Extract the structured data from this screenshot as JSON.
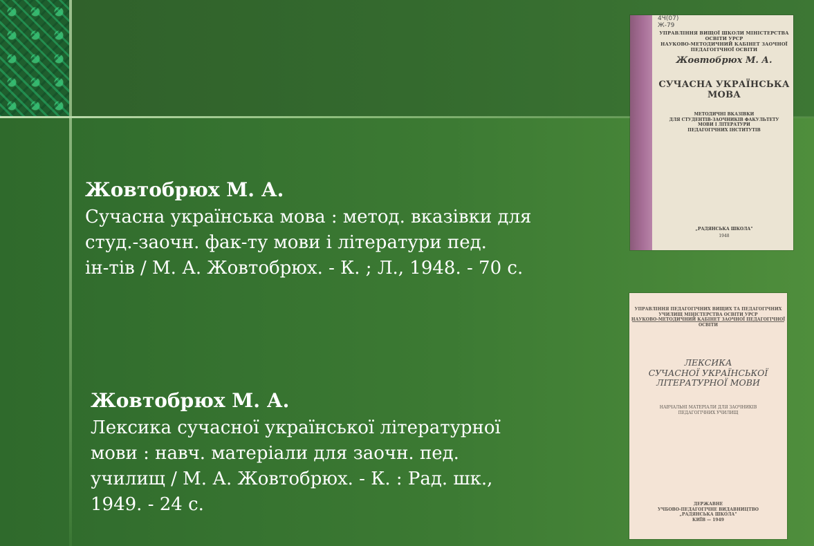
{
  "entries": [
    {
      "author": "Жовтобрюх М. А.",
      "description": "Сучасна українська мова : метод. вказівки для\nстуд.-заочн. фак-ту мови і літератури пед.\nін-тів / М. А. Жовтобрюх. - К. ; Л., 1948. - 70 с."
    },
    {
      "author": "Жовтобрюх М. А.",
      "description": "Лексика сучасної української літературної\nмови : навч. матеріали для заочн. пед.\nучилищ / М. А. Жовтобрюх. - К. : Рад. шк.,\n1949. - 24 с."
    }
  ],
  "covers": [
    {
      "shelf_mark": "4Ч(07)\nЖ-79",
      "header": "УПРАВЛІННЯ ВИЩОЇ ШКОЛИ МІНІСТЕРСТВА ОСВІТИ УРСР\nНАУКОВО-МЕТОДИЧНИЙ КАБІНЕТ ЗАОЧНОЇ ПЕДАГОГІЧНОЇ ОСВІТИ",
      "author": "Жовтобрюх М. А.",
      "title": "СУЧАСНА УКРАЇНСЬКА МОВА",
      "subtitle": "МЕТОДИЧНІ ВКАЗІВКИ\nДЛЯ СТУДЕНТІВ-ЗАОЧНИКІВ ФАКУЛЬТЕТУ\nМОВИ І ЛІТЕРАТУРИ\nПЕДАГОГІЧНИХ ІНСТИТУТІВ",
      "publisher": "„РАДЯНСЬКА ШКОЛА\"",
      "year": "1948"
    },
    {
      "header": "УПРАВЛІННЯ ПЕДАГОГІЧНИХ ВИЩИХ ТА ПЕДАГОГІЧНИХ\nУЧИЛИЩ МІНІСТЕРСТВА ОСВІТИ УРСР\nНАУКОВО-МЕТОДИЧНИЙ КАБІНЕТ ЗАОЧНОЇ ПЕДАГОГІЧНОЇ ОСВІТИ",
      "title": "ЛЕКСИКА\nСУЧАСНОЇ УКРАЇНСЬКОЇ\nЛІТЕРАТУРНОЇ МОВИ",
      "subtitle": "НАВЧАЛЬНІ МАТЕРІАЛИ ДЛЯ ЗАОЧНИКІВ\nПЕДАГОГІЧНИХ УЧИЛИЩ",
      "publisher": "ДЕРЖАВНЕ\nУЧБОВО-ПЕДАГОГІЧНЕ ВИДАВНИЦТВО\n„РАДЯНСЬКА ШКОЛА\"\nКИЇВ — 1949"
    }
  ],
  "colors": {
    "background": "#3c7a33",
    "text": "#ffffff",
    "spine": "#a87098"
  }
}
